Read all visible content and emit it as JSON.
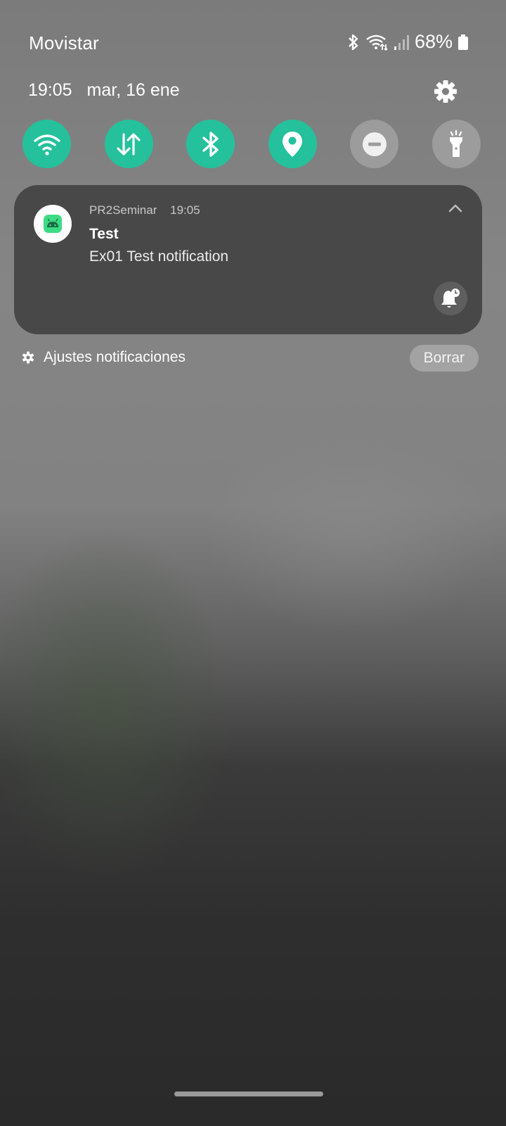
{
  "status_bar": {
    "carrier": "Movistar",
    "battery_percent": "68%",
    "icons": [
      "bluetooth-icon",
      "wifi-signal-icon",
      "cell-signal-icon",
      "battery-icon"
    ]
  },
  "header": {
    "time": "19:05",
    "date": "mar, 16 ene",
    "settings_icon": "gear-icon"
  },
  "quick_settings": [
    {
      "name": "wifi",
      "icon": "wifi-icon",
      "active": true
    },
    {
      "name": "mobile-data",
      "icon": "data-transfer-icon",
      "active": true
    },
    {
      "name": "bluetooth",
      "icon": "bluetooth-icon",
      "active": true
    },
    {
      "name": "location",
      "icon": "location-icon",
      "active": true
    },
    {
      "name": "do-not-disturb",
      "icon": "minus-circle-icon",
      "active": false
    },
    {
      "name": "flashlight",
      "icon": "flashlight-icon",
      "active": false
    }
  ],
  "notification": {
    "app_name": "PR2Seminar",
    "time": "19:05",
    "title": "Test",
    "text": "Ex01 Test notification",
    "app_icon": "android-icon"
  },
  "footer": {
    "settings_label": "Ajustes notificaciones",
    "clear_label": "Borrar"
  },
  "colors": {
    "accent": "#24c19c",
    "card": "#484848"
  }
}
